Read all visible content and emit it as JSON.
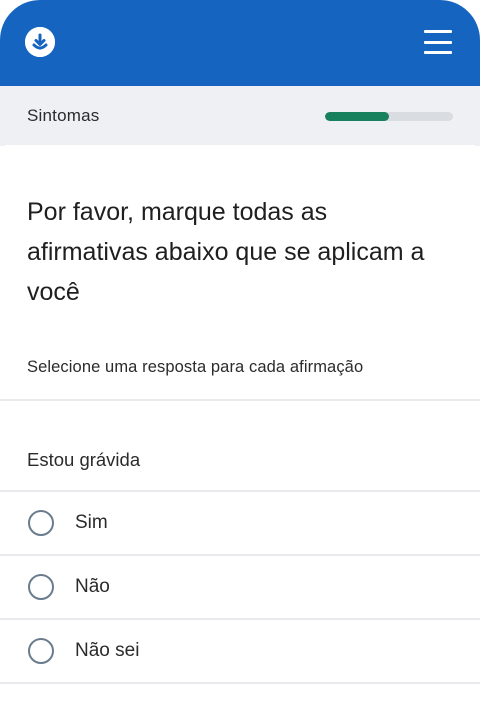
{
  "header": {
    "logo_icon": "download-circle-icon",
    "menu_icon": "hamburger-menu-icon",
    "brand_color": "#1565c0"
  },
  "progress": {
    "section_label": "Sintomas",
    "fraction": 0.5,
    "fill_color": "#17805c"
  },
  "question": {
    "title": "Por favor, marque todas as afirmativas abaixo que se aplicam a você",
    "hint": "Selecione uma resposta para cada afirmação",
    "statement": "Estou grávida",
    "options": [
      {
        "label": "Sim",
        "selected": false
      },
      {
        "label": "Não",
        "selected": false
      },
      {
        "label": "Não sei",
        "selected": false
      }
    ]
  }
}
